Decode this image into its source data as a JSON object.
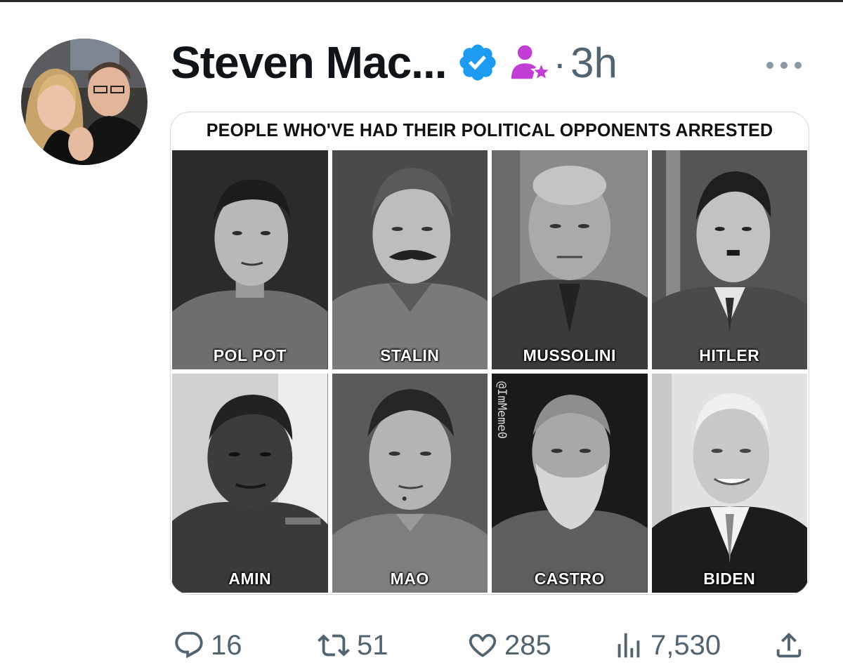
{
  "post": {
    "display_name": "Steven Mac...",
    "separator": "·",
    "timestamp": "3h"
  },
  "media": {
    "title": "PEOPLE WHO'VE HAD THEIR POLITICAL OPPONENTS ARRESTED",
    "watermark": "@ImMeme0",
    "portraits": [
      {
        "name": "POL POT"
      },
      {
        "name": "STALIN"
      },
      {
        "name": "MUSSOLINI"
      },
      {
        "name": "HITLER"
      },
      {
        "name": "AMIN"
      },
      {
        "name": "MAO"
      },
      {
        "name": "CASTRO"
      },
      {
        "name": "BIDEN"
      }
    ]
  },
  "actions": {
    "replies": "16",
    "reposts": "51",
    "likes": "285",
    "views": "7,530"
  },
  "icons": {
    "verified": "verified-badge-icon",
    "subscriber": "subscriber-star-icon",
    "more": "more-dots-icon",
    "reply": "reply-icon",
    "repost": "repost-icon",
    "like": "heart-icon",
    "views": "views-chart-icon",
    "share": "share-icon"
  },
  "colors": {
    "verified": "#1d9bf0",
    "subscriber": "#c13ed4",
    "secondary_text": "#536471"
  }
}
